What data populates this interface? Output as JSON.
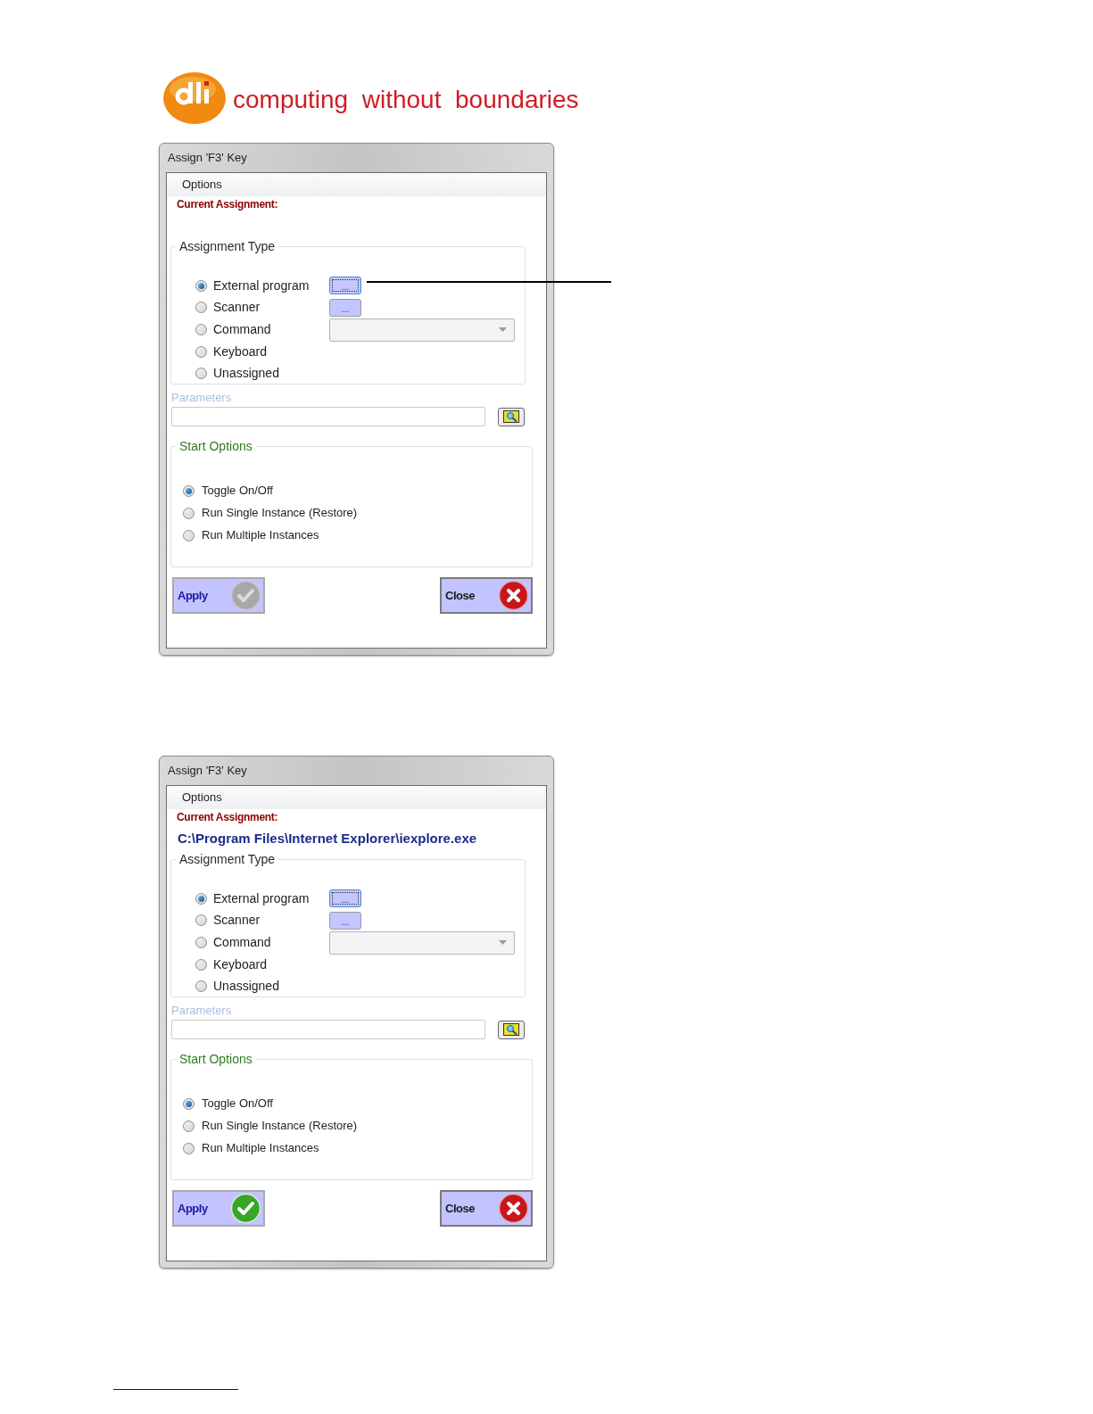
{
  "header": {
    "tagline": "computing  without  boundaries"
  },
  "dialogs": [
    {
      "title": "Assign 'F3' Key",
      "menu": "Options",
      "current_label": "Current Assignment:",
      "assignment_type": {
        "legend": "Assignment Type",
        "options": [
          {
            "label": "External program",
            "selected": true,
            "kind": "browse",
            "control_text": "...",
            "focused": true
          },
          {
            "label": "Scanner",
            "selected": false,
            "kind": "browse",
            "control_text": "...",
            "focused": false
          },
          {
            "label": "Command",
            "selected": false,
            "kind": "dropdown"
          },
          {
            "label": "Keyboard",
            "selected": false,
            "kind": "plain"
          },
          {
            "label": "Unassigned",
            "selected": false,
            "kind": "plain"
          }
        ]
      },
      "parameters_label": "Parameters",
      "start_options": {
        "legend": "Start Options",
        "options": [
          {
            "label": "Toggle On/Off",
            "selected": true
          },
          {
            "label": "Run Single Instance (Restore)",
            "selected": false
          },
          {
            "label": "Run Multiple Instances",
            "selected": false
          }
        ]
      },
      "apply": {
        "label": "Apply",
        "disabled": true
      },
      "close": {
        "label": "Close"
      },
      "leader": true
    },
    {
      "title": "Assign 'F3' Key",
      "menu": "Options",
      "current_label": "Current Assignment:",
      "current_value": "C:\\Program Files\\Internet Explorer\\iexplore.exe",
      "assignment_type": {
        "legend": "Assignment Type",
        "options": [
          {
            "label": "External program",
            "selected": true,
            "kind": "browse",
            "control_text": "...",
            "focused": true
          },
          {
            "label": "Scanner",
            "selected": false,
            "kind": "browse",
            "control_text": "...",
            "focused": false
          },
          {
            "label": "Command",
            "selected": false,
            "kind": "dropdown"
          },
          {
            "label": "Keyboard",
            "selected": false,
            "kind": "plain"
          },
          {
            "label": "Unassigned",
            "selected": false,
            "kind": "plain"
          }
        ]
      },
      "parameters_label": "Parameters",
      "start_options": {
        "legend": "Start Options",
        "options": [
          {
            "label": "Toggle On/Off",
            "selected": true
          },
          {
            "label": "Run Single Instance (Restore)",
            "selected": false
          },
          {
            "label": "Run Multiple Instances",
            "selected": false
          }
        ]
      },
      "apply": {
        "label": "Apply",
        "disabled": false
      },
      "close": {
        "label": "Close"
      },
      "leader": false
    }
  ]
}
